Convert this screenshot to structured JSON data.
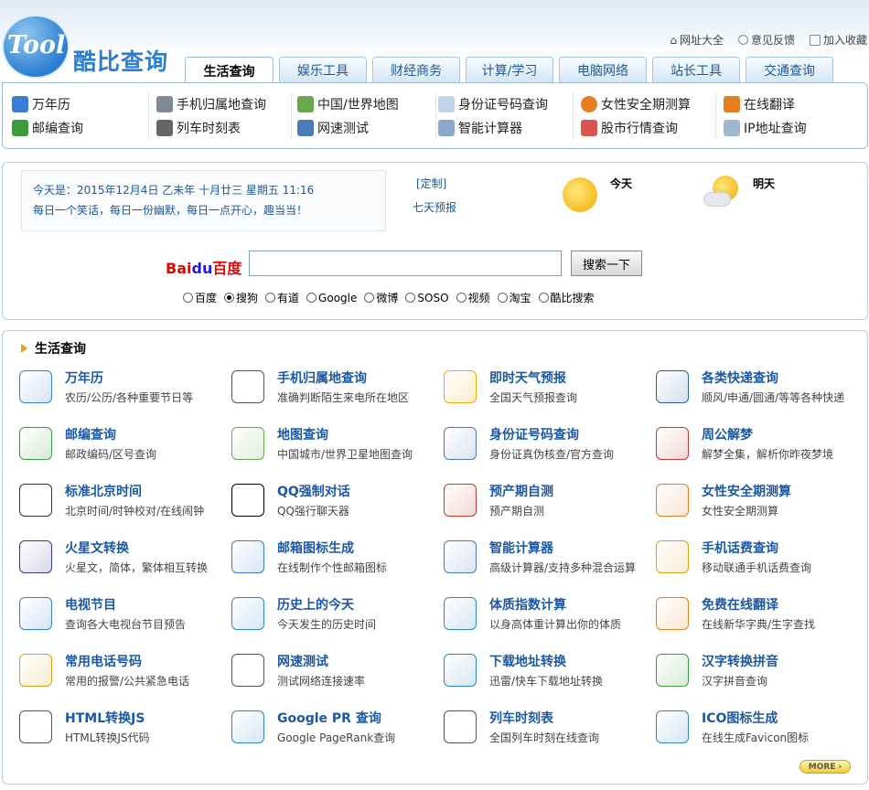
{
  "brand": {
    "logo_text": "Tool",
    "site_name": "酷比查询"
  },
  "top_links": [
    {
      "label": "网址大全",
      "icon": "home-icon"
    },
    {
      "label": "意见反馈",
      "icon": "feedback-icon"
    },
    {
      "label": "加入收藏",
      "icon": "bookmark-icon"
    }
  ],
  "tabs": [
    {
      "label": "生活查询",
      "active": true
    },
    {
      "label": "娱乐工具"
    },
    {
      "label": "财经商务"
    },
    {
      "label": "计算/学习"
    },
    {
      "label": "电脑网络"
    },
    {
      "label": "站长工具"
    },
    {
      "label": "交通查询"
    }
  ],
  "menu": [
    [
      "万年历",
      "邮编查询"
    ],
    [
      "手机归属地查询",
      "列车时刻表"
    ],
    [
      "中国/世界地图",
      "网速测试"
    ],
    [
      "身份证号码查询",
      "智能计算器"
    ],
    [
      "女性安全期测算",
      "股市行情查询"
    ],
    [
      "在线翻译",
      "IP地址查询"
    ]
  ],
  "info": {
    "date_line": "今天是：2015年12月4日 乙未年 十月廿三 星期五 11:16",
    "slogan": "每日一个笑话，每日一份幽默，每日一点开心，趣当当！",
    "custom": "[定制]",
    "seven_day": "七天预报",
    "today": "今天",
    "tomorrow": "明天"
  },
  "search": {
    "engine_logo": "Bai百度",
    "button": "搜索一下",
    "value": "",
    "options": [
      "百度",
      "搜狗",
      "有道",
      "Google",
      "微博",
      "SOSO",
      "视频",
      "淘宝",
      "酷比搜索"
    ],
    "selected": "搜狗"
  },
  "section": {
    "title": "生活查询",
    "more": "MORE",
    "items": [
      [
        {
          "t": "万年历",
          "d": "农历/公历/各种重要节日等",
          "icon": "calendar-icon",
          "c": "#3a7bd5"
        },
        {
          "t": "手机归属地查询",
          "d": "准确判断陌生来电所在地区",
          "icon": "phone-icon",
          "c": "#555"
        },
        {
          "t": "即时天气预报",
          "d": "全国天气预报查询",
          "icon": "weather-icon",
          "c": "#f5a800"
        },
        {
          "t": "各类快递查询",
          "d": "顺风/申通/圆通/等等各种快递",
          "icon": "mail-icon",
          "c": "#2b5fa6"
        }
      ],
      [
        {
          "t": "邮编查询",
          "d": "邮政编码/区号查询",
          "icon": "postbox-icon",
          "c": "#3c9c3c"
        },
        {
          "t": "地图查询",
          "d": "中国城市/世界卫星地图查询",
          "icon": "map-icon",
          "c": "#6aa84f"
        },
        {
          "t": "身份证号码查询",
          "d": "身份证真伪核查/官方查询",
          "icon": "id-card-icon",
          "c": "#4a7ab8"
        },
        {
          "t": "周公解梦",
          "d": "解梦全集，解析你昨夜梦境",
          "icon": "fortune-icon",
          "c": "#c0392b"
        }
      ],
      [
        {
          "t": "标准北京时间",
          "d": "北京时间/时钟校对/在线闹钟",
          "icon": "clock-icon",
          "c": "#333"
        },
        {
          "t": "QQ强制对话",
          "d": "QQ强行聊天器",
          "icon": "penguin-icon",
          "c": "#000"
        },
        {
          "t": "预产期自测",
          "d": "预产期自测",
          "icon": "date-icon",
          "c": "#c0392b"
        },
        {
          "t": "女性安全期测算",
          "d": "女性安全期测算",
          "icon": "woman-icon",
          "c": "#e67e22"
        }
      ],
      [
        {
          "t": "火星文转换",
          "d": "火星文，简体，繁体相互转换",
          "icon": "symbols-icon",
          "c": "#3a3a8a"
        },
        {
          "t": "邮箱图标生成",
          "d": "在线制作个性邮箱图标",
          "icon": "email-icon",
          "c": "#3a7bd5"
        },
        {
          "t": "智能计算器",
          "d": "高级计算器/支持多种混合运算",
          "icon": "calculator-icon",
          "c": "#4a7ab8"
        },
        {
          "t": "手机话费查询",
          "d": "移动联通手机话费查询",
          "icon": "coin-icon",
          "c": "#d4a017"
        }
      ],
      [
        {
          "t": "电视节目",
          "d": "查询各大电视台节目预告",
          "icon": "tv-icon",
          "c": "#3a7bd5"
        },
        {
          "t": "历史上的今天",
          "d": "今天发生的历史时间",
          "icon": "history-icon",
          "c": "#2e86c1"
        },
        {
          "t": "体质指数计算",
          "d": "以身高体重计算出你的体质",
          "icon": "people-icon",
          "c": "#2e86c1"
        },
        {
          "t": "免费在线翻译",
          "d": "在线新华字典/生字查找",
          "icon": "translate-icon",
          "c": "#e67e22"
        }
      ],
      [
        {
          "t": "常用电话号码",
          "d": "常用的报警/公共紧急电话",
          "icon": "telephone-icon",
          "c": "#d4a017"
        },
        {
          "t": "网速测试",
          "d": "测试网络连接速率",
          "icon": "network-icon",
          "c": "#555"
        },
        {
          "t": "下载地址转换",
          "d": "迅雷/快车下载地址转换",
          "icon": "bird-icon",
          "c": "#2e86c1"
        },
        {
          "t": "汉字转换拼音",
          "d": "汉字拼音查询",
          "icon": "pinyin-icon",
          "c": "#3c9c3c"
        }
      ],
      [
        {
          "t": "HTML转换JS",
          "d": "HTML转换JS代码",
          "icon": "html-js-icon",
          "c": "#555"
        },
        {
          "t": "Google PR 查询",
          "d": "Google PageRank查询",
          "icon": "pagerank-icon",
          "c": "#2e86c1"
        },
        {
          "t": "列车时刻表",
          "d": "全国列车时刻在线查询",
          "icon": "train-icon",
          "c": "#555"
        },
        {
          "t": "ICO图标生成",
          "d": "在线生成Favicon图标",
          "icon": "footprint-icon",
          "c": "#2e86c1"
        }
      ]
    ]
  }
}
